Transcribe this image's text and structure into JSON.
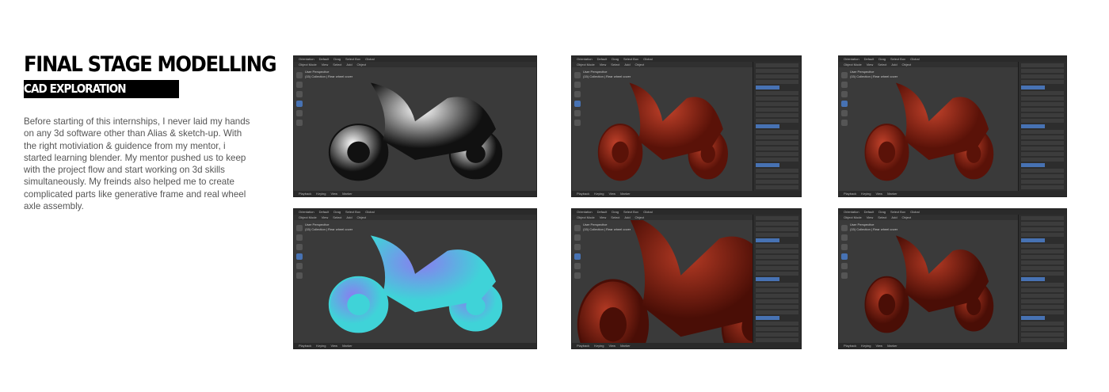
{
  "heading": {
    "title": "FINAL STAGE MODELLING",
    "subtitle": "CAD EXPLORATION"
  },
  "description": "Before starting of this internships, I never laid my hands on any 3d software other than Alias & sketch-up. With the right motiviation & guidence from my mentor, i started learning blender. My mentor pushed us to keep with the project flow and start working on 3d skills simultaneously. My freinds also helped me to create complicated parts like generative frame and real wheel axle assembly.",
  "viewport_ui": {
    "menu": [
      "Object Mode",
      "View",
      "Select",
      "Add",
      "Object"
    ],
    "top": [
      "Orientation",
      "Default",
      "Drag",
      "Select Box",
      "Global"
    ],
    "overlay_title": "User Perspective",
    "overlay_sub": "(15) Collection | Rear wheel cover",
    "footer": [
      "Playback",
      "Keying",
      "View",
      "Marker"
    ]
  },
  "renders": [
    {
      "shading": "reflection",
      "colors": [
        "#ffffff",
        "#111111"
      ],
      "sidebar": false
    },
    {
      "shading": "copper",
      "colors": [
        "#c0412a",
        "#5a1208"
      ],
      "sidebar": true
    },
    {
      "shading": "copper",
      "colors": [
        "#c0412a",
        "#5a1208"
      ],
      "sidebar": true
    },
    {
      "shading": "normal",
      "colors": [
        "#8a7cf0",
        "#3fd3d8"
      ],
      "sidebar": false
    },
    {
      "shading": "copper-closeup",
      "colors": [
        "#b43a24",
        "#4a0e06"
      ],
      "sidebar": true
    },
    {
      "shading": "copper",
      "colors": [
        "#b43a24",
        "#4a0e06"
      ],
      "sidebar": true
    }
  ]
}
